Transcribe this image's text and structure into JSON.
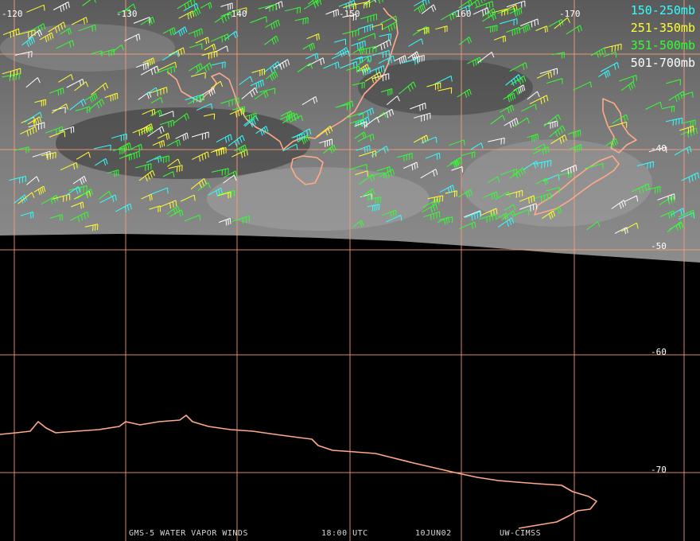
{
  "footer": {
    "satellite": "GMS-5 WATER VAPOR WINDS",
    "time": "18:00 UTC",
    "date": "10JUN02",
    "source": "UW-CIMSS"
  },
  "longitude_labels": [
    "-120",
    "-130",
    "-140",
    "-150",
    "-160",
    "-170"
  ],
  "latitude_labels": [
    "-40",
    "-50",
    "-60",
    "-70"
  ],
  "legend": [
    {
      "label": "150-250mb",
      "color": "#33ffff"
    },
    {
      "label": "251-350mb",
      "color": "#ffff33"
    },
    {
      "label": "351-500mb",
      "color": "#33ff33"
    },
    {
      "label": "501-700mb",
      "color": "#ffffff"
    }
  ],
  "colors": {
    "background": "#000000",
    "grid": "#ff9f7a",
    "coastline": "#ffaa88",
    "imagery": "#6e6e6e"
  },
  "icons": [
    "wind-barb-icon"
  ]
}
